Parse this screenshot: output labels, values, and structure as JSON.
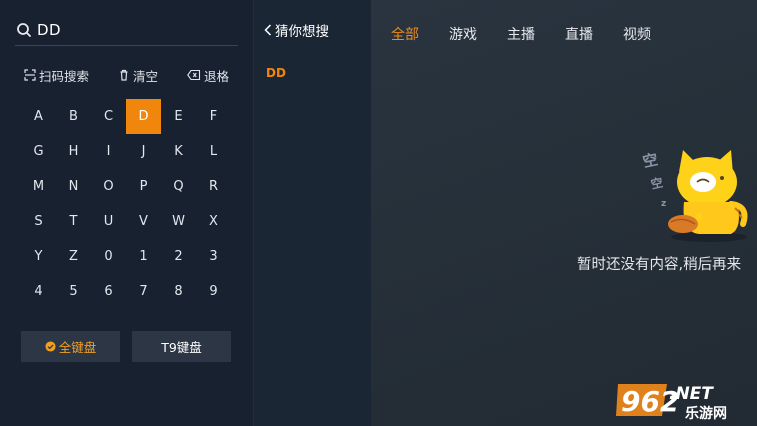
{
  "search": {
    "query": "DD"
  },
  "actions": [
    {
      "label": "扫码搜索",
      "icon": "scan-icon"
    },
    {
      "label": "清空",
      "icon": "trash-icon"
    },
    {
      "label": "退格",
      "icon": "backspace-icon"
    }
  ],
  "keys": [
    "A",
    "B",
    "C",
    "D",
    "E",
    "F",
    "G",
    "H",
    "I",
    "J",
    "K",
    "L",
    "M",
    "N",
    "O",
    "P",
    "Q",
    "R",
    "S",
    "T",
    "U",
    "V",
    "W",
    "X",
    "Y",
    "Z",
    "0",
    "1",
    "2",
    "3",
    "4",
    "5",
    "6",
    "7",
    "8",
    "9"
  ],
  "active_key": "D",
  "keyboard_modes": {
    "full": "全键盘",
    "t9": "T9键盘"
  },
  "suggest": {
    "title": "猜你想搜",
    "items": [
      "DD"
    ]
  },
  "tabs": [
    "全部",
    "游戏",
    "主播",
    "直播",
    "视频"
  ],
  "active_tab": "全部",
  "empty_message": "暂时还没有内容,稍后再来",
  "watermark": {
    "number": "962",
    "suffix": ".NET",
    "site": "乐游网"
  },
  "colors": {
    "accent": "#f0860c",
    "panel": "#17212f",
    "text": "#e3e7ee"
  }
}
